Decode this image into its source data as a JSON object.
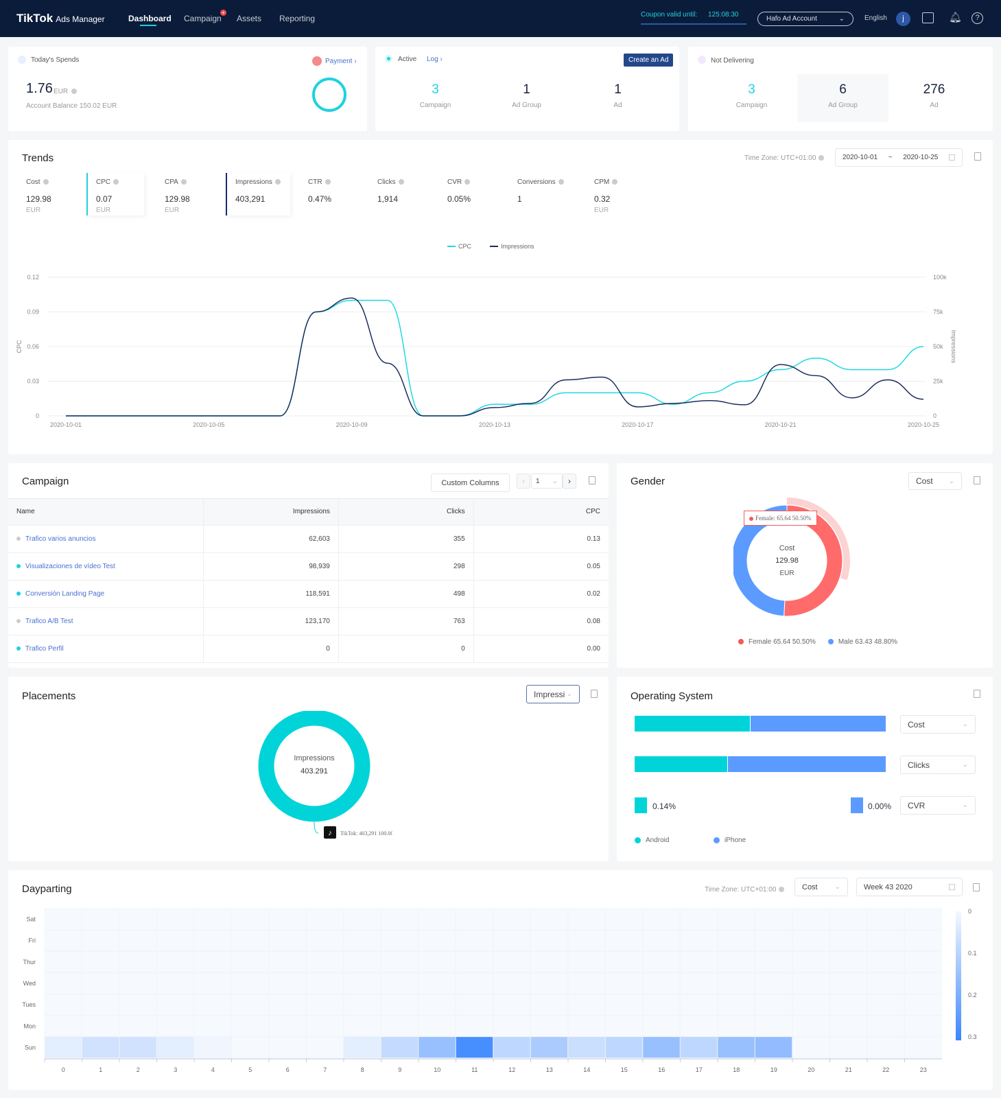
{
  "header": {
    "brand": "TikTok",
    "brand_suffix": "Ads Manager",
    "nav": [
      {
        "label": "Dashboard",
        "active": true
      },
      {
        "label": "Campaign",
        "badge": "+"
      },
      {
        "label": "Assets"
      },
      {
        "label": "Reporting"
      }
    ],
    "coupon_label": "Coupon valid until:",
    "coupon_time": "125:08:30",
    "account": "Hafo Ad Account",
    "language": "English",
    "avatar": "j"
  },
  "spends": {
    "title": "Today's Spends",
    "amount": "1.76",
    "currency": "EUR",
    "balance": "Account Balance 150.02 EUR",
    "payment": "Payment"
  },
  "active": {
    "title": "Active",
    "log": "Log",
    "create": "Create an Ad",
    "stats": [
      {
        "value": "3",
        "label": "Campaign"
      },
      {
        "value": "1",
        "label": "Ad Group"
      },
      {
        "value": "1",
        "label": "Ad"
      }
    ]
  },
  "not_delivering": {
    "title": "Not Delivering",
    "stats": [
      {
        "value": "3",
        "label": "Campaign"
      },
      {
        "value": "6",
        "label": "Ad Group"
      },
      {
        "value": "276",
        "label": "Ad"
      }
    ]
  },
  "trends": {
    "title": "Trends",
    "timezone": "Time Zone: UTC+01:00",
    "date_from": "2020-10-01",
    "date_sep": "~",
    "date_to": "2020-10-25",
    "metrics": [
      {
        "label": "Cost",
        "value": "129.98",
        "unit": "EUR"
      },
      {
        "label": "CPC",
        "value": "0.07",
        "unit": "EUR",
        "selected": "#1fd1e0"
      },
      {
        "label": "CPA",
        "value": "129.98",
        "unit": "EUR"
      },
      {
        "label": "Impressions",
        "value": "403,291",
        "selected": "#1a2a6c"
      },
      {
        "label": "CTR",
        "value": "0.47%"
      },
      {
        "label": "Clicks",
        "value": "1,914"
      },
      {
        "label": "CVR",
        "value": "0.05%"
      },
      {
        "label": "Conversions",
        "value": "1"
      },
      {
        "label": "CPM",
        "value": "0.32",
        "unit": "EUR"
      }
    ]
  },
  "chart_data": [
    {
      "type": "line",
      "ylabel": "CPC",
      "y2label": "Impressions",
      "ylim": [
        0,
        0.12
      ],
      "y2lim": [
        0,
        100000
      ],
      "yticks": [
        "0",
        "0.03",
        "0.06",
        "0.09",
        "0.12"
      ],
      "y2ticks": [
        "0",
        "25k",
        "50k",
        "75k",
        "100k"
      ],
      "xticks": [
        "2020-10-01",
        "2020-10-05",
        "2020-10-09",
        "2020-10-13",
        "2020-10-17",
        "2020-10-21",
        "2020-10-25"
      ],
      "legend": "top-center",
      "grid": true,
      "x": [
        "2020-10-01",
        "2020-10-02",
        "2020-10-03",
        "2020-10-04",
        "2020-10-05",
        "2020-10-06",
        "2020-10-07",
        "2020-10-08",
        "2020-10-09",
        "2020-10-10",
        "2020-10-11",
        "2020-10-12",
        "2020-10-13",
        "2020-10-14",
        "2020-10-15",
        "2020-10-16",
        "2020-10-17",
        "2020-10-18",
        "2020-10-19",
        "2020-10-20",
        "2020-10-21",
        "2020-10-22",
        "2020-10-23",
        "2020-10-24",
        "2020-10-25"
      ],
      "series": [
        {
          "name": "CPC",
          "axis": "left",
          "color": "#1fd8e3",
          "values": [
            0,
            0,
            0,
            0,
            0,
            0,
            0,
            0.09,
            0.1,
            0.1,
            0,
            0,
            0.01,
            0.01,
            0.02,
            0.02,
            0.02,
            0.01,
            0.02,
            0.03,
            0.04,
            0.05,
            0.04,
            0.04,
            0.06
          ]
        },
        {
          "name": "Impressions",
          "axis": "right",
          "color": "#1b2d5c",
          "values": [
            0,
            0,
            0,
            0,
            0,
            0,
            0,
            75000,
            85000,
            38000,
            0,
            0,
            6000,
            9000,
            26000,
            28000,
            6500,
            9000,
            11000,
            8000,
            37000,
            29000,
            13000,
            26000,
            12000
          ]
        }
      ]
    },
    {
      "type": "pie",
      "title": "Gender",
      "center_label": "Cost",
      "center_value": "129.98",
      "center_unit": "EUR",
      "tooltip": "Female: 65.64 50.50%",
      "slices": [
        {
          "name": "Female",
          "value": 65.64,
          "percent": 50.5,
          "label": "Female 65.64 50.50%",
          "color": "#f15b5b"
        },
        {
          "name": "Male",
          "value": 63.43,
          "percent": 48.8,
          "label": "Male 63.43 48.80%",
          "color": "#5b9bff"
        }
      ]
    },
    {
      "type": "pie",
      "title": "Placements",
      "center_label": "Impressions",
      "center_value": "403.291",
      "slices": [
        {
          "name": "TikTok",
          "value": 403291,
          "percent": 100,
          "label": "TikTok: 403,291 100.00%",
          "color": "#00d4d8"
        }
      ]
    },
    {
      "type": "bar",
      "title": "Operating System",
      "series": [
        {
          "name": "Android",
          "color": "#00d4d8"
        },
        {
          "name": "iPhone",
          "color": "#5b9bff"
        }
      ],
      "rows": [
        {
          "metric": "Cost",
          "android_share": 0.46
        },
        {
          "metric": "Clicks",
          "android_share": 0.37
        },
        {
          "metric": "CVR",
          "android": "0.14%",
          "iphone": "0.00%"
        }
      ]
    },
    {
      "type": "heatmap",
      "title": "Dayparting",
      "rows": [
        "Sat",
        "Fri",
        "Thur",
        "Wed",
        "Tues",
        "Mon",
        "Sun"
      ],
      "columns": [
        "0",
        "1",
        "2",
        "3",
        "4",
        "5",
        "6",
        "7",
        "8",
        "9",
        "10",
        "11",
        "12",
        "13",
        "14",
        "15",
        "16",
        "17",
        "18",
        "19",
        "20",
        "21",
        "22",
        "23"
      ],
      "scale": [
        0,
        0.3
      ],
      "scale_ticks": [
        "0",
        "0.1",
        "0.2",
        "0.3"
      ],
      "sun_values": [
        0.03,
        0.06,
        0.06,
        0.03,
        0.01,
        0,
        0,
        0,
        0.03,
        0.08,
        0.15,
        0.28,
        0.09,
        0.12,
        0.07,
        0.09,
        0.15,
        0.09,
        0.15,
        0.16,
        0,
        0,
        0,
        0
      ]
    }
  ],
  "campaign": {
    "title": "Campaign",
    "custom_columns": "Custom Columns",
    "page": "1",
    "columns": [
      "Name",
      "Impressions",
      "Clicks",
      "CPC"
    ],
    "rows": [
      {
        "name": "Trafico varios anuncios",
        "status": "#cccccc",
        "impressions": "62,603",
        "clicks": "355",
        "cpc": "0.13"
      },
      {
        "name": "Visualizaciones de vídeo Test",
        "status": "#1fd1e0",
        "impressions": "98,939",
        "clicks": "298",
        "cpc": "0.05"
      },
      {
        "name": "Conversión Landing Page",
        "status": "#1fd1e0",
        "impressions": "118,591",
        "clicks": "498",
        "cpc": "0.02"
      },
      {
        "name": "Trafico A/B Test",
        "status": "#cccccc",
        "impressions": "123,170",
        "clicks": "763",
        "cpc": "0.08"
      },
      {
        "name": "Trafico Perfil",
        "status": "#1fd1e0",
        "impressions": "0",
        "clicks": "0",
        "cpc": "0.00"
      }
    ]
  },
  "gender": {
    "title": "Gender",
    "metric": "Cost"
  },
  "placements": {
    "title": "Placements",
    "metric": "Impressi"
  },
  "os": {
    "title": "Operating System",
    "selects": [
      "Cost",
      "Clicks",
      "CVR"
    ],
    "android_cvr": "0.14%",
    "iphone_cvr": "0.00%",
    "legend": [
      "Android",
      "iPhone"
    ]
  },
  "dayparting": {
    "title": "Dayparting",
    "timezone": "Time Zone: UTC+01:00",
    "metric": "Cost",
    "week": "Week 43 2020"
  }
}
